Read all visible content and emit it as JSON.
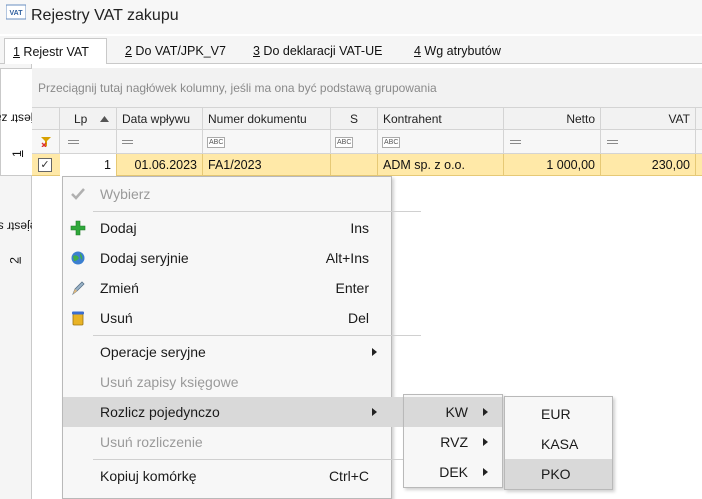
{
  "window": {
    "title": "Rejestry VAT zakupu",
    "icon_text": "VAT"
  },
  "tabs": [
    {
      "key": "1",
      "label": " Rejestr VAT"
    },
    {
      "key": "2",
      "label": " Do VAT/JPK_V7"
    },
    {
      "key": "3",
      "label": " Do deklaracji VAT-UE"
    },
    {
      "key": "4",
      "label": " Wg atrybutów"
    }
  ],
  "side_tabs": [
    {
      "key": "1",
      "label": " Rejestr zak."
    },
    {
      "key": "2",
      "label": " Rejestr spr."
    }
  ],
  "grid": {
    "group_hint": "Przeciągnij tutaj nagłówek kolumny, jeśli ma ona być podstawą grupowania",
    "columns": [
      "Lp",
      "Data wpływu",
      "Numer dokumentu",
      "S",
      "Kontrahent",
      "Netto",
      "VAT"
    ],
    "filter_abc": "ABC",
    "row": {
      "lp": "1",
      "data_wplywu": "01.06.2023",
      "numer": "FA1/2023",
      "s": "",
      "kontrahent": "ADM sp. z o.o.",
      "netto": "1 000,00",
      "vat": "230,00"
    }
  },
  "context_menu": {
    "items": [
      {
        "label": "Wybierz",
        "shortcut": ""
      },
      {
        "label": "Dodaj",
        "shortcut": "Ins"
      },
      {
        "label": "Dodaj seryjnie",
        "shortcut": "Alt+Ins"
      },
      {
        "label": "Zmień",
        "shortcut": "Enter"
      },
      {
        "label": "Usuń",
        "shortcut": "Del"
      },
      {
        "label": "Operacje seryjne"
      },
      {
        "label": "Usuń zapisy księgowe"
      },
      {
        "label": "Rozlicz pojedynczo"
      },
      {
        "label": "Usuń rozliczenie"
      },
      {
        "label": "Kopiuj komórkę",
        "shortcut": "Ctrl+C"
      }
    ]
  },
  "submenu": {
    "items": [
      "KW",
      "RVZ",
      "DEK"
    ]
  },
  "submenu2": {
    "items": [
      "EUR",
      "KASA",
      "PKO"
    ]
  },
  "colors": {
    "selected_row": "#ffe9a8",
    "menu_highlight": "#d9d9d9",
    "accent_blue": "#2f6fb6"
  }
}
